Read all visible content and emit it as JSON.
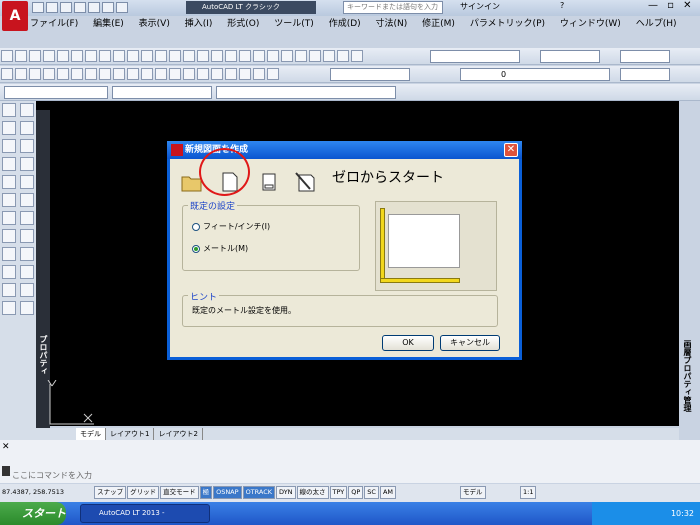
{
  "app": {
    "logo": "A",
    "workspace": "AutoCAD LT クラシック",
    "search_placeholder": "キーワードまたは語句を入力",
    "signin": "サインイン",
    "help": "?",
    "window_controls": "— ▫ ✕",
    "logo_icon": "autocad-logo-icon"
  },
  "menu": [
    "ファイル(F)",
    "編集(E)",
    "表示(V)",
    "挿入(I)",
    "形式(O)",
    "ツール(T)",
    "作成(D)",
    "寸法(N)",
    "修正(M)",
    "パラメトリック(P)",
    "ウィンドウ(W)",
    "ヘルプ(H)"
  ],
  "toolbar": {
    "layer_value": "0"
  },
  "sidebar": {
    "properties_label": "プロパティ",
    "palette_label": "画層プロパティ管理"
  },
  "tabs": [
    "モデル",
    "レイアウト1",
    "レイアウト2"
  ],
  "command": {
    "placeholder": "ここにコマンドを入力"
  },
  "status": {
    "coords": "87.4387, 258.7513",
    "toggles": [
      "スナップ",
      "グリッド",
      "直交モード",
      "極",
      "OSNAP",
      "OTRACK",
      "DYN",
      "線の太さ",
      "TPY",
      "QP",
      "SC",
      "AM"
    ],
    "model": "モデル",
    "scale": "1:1"
  },
  "taskbar": {
    "start": "スタート",
    "task": "AutoCAD LT 2013 -",
    "clock": "10:32"
  },
  "dialog": {
    "title": "新規図面を作成",
    "close": "✕",
    "heading": "ゼロからスタート",
    "group_label": "既定の設定",
    "options": [
      "フィート/インチ(I)",
      "メートル(M)"
    ],
    "selected_option": "メートル(M)",
    "hint_label": "ヒント",
    "hint_text": "既定のメートル設定を使用。",
    "ok": "OK",
    "cancel": "キャンセル",
    "icons": [
      "open-folder-icon",
      "start-from-scratch-icon",
      "template-icon",
      "wizard-icon"
    ]
  }
}
